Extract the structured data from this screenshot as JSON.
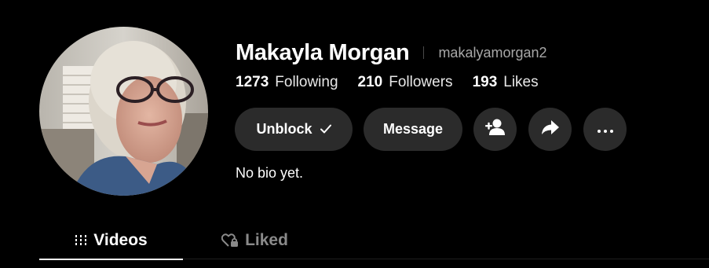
{
  "profile": {
    "display_name": "Makayla Morgan",
    "username": "makalyamorgan2",
    "bio": "No bio yet."
  },
  "stats": [
    {
      "count": "1273",
      "label": "Following"
    },
    {
      "count": "210",
      "label": "Followers"
    },
    {
      "count": "193",
      "label": "Likes"
    }
  ],
  "actions": {
    "unblock_label": "Unblock",
    "unblock_icon": "check-icon",
    "message_label": "Message",
    "icons": [
      "add-friend-icon",
      "share-icon",
      "more-icon"
    ]
  },
  "tabs": [
    {
      "label": "Videos",
      "icon": "grid-bars-icon",
      "active": true
    },
    {
      "label": "Liked",
      "icon": "heart-lock-icon",
      "active": false
    }
  ],
  "colors": {
    "background": "#000000",
    "button_bg": "#2b2b2b",
    "muted_text": "#a8a8a8",
    "inactive_tab": "#8a8a8a"
  }
}
